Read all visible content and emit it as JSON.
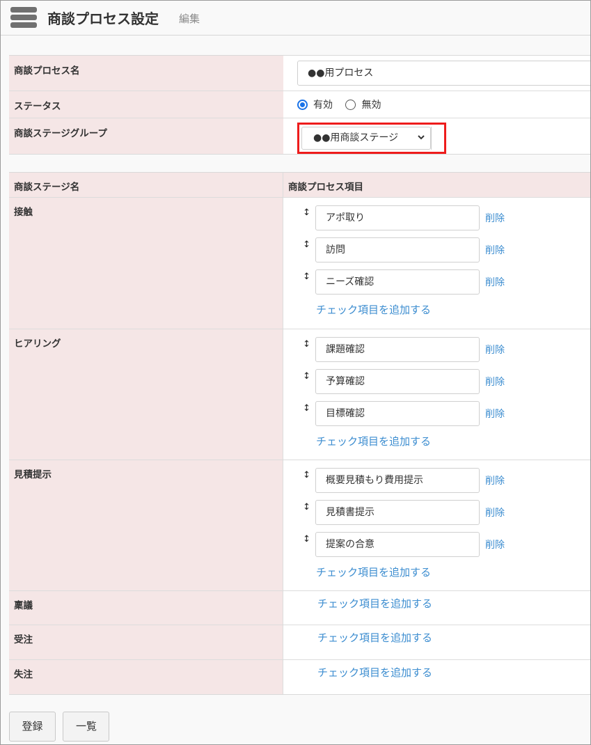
{
  "header": {
    "title": "商談プロセス設定",
    "subtitle": "編集"
  },
  "form": {
    "process_name": {
      "label": "商談プロセス名",
      "value": "●●用プロセス"
    },
    "status": {
      "label": "ステータス",
      "options": [
        "有効",
        "無効"
      ],
      "selected": "有効"
    },
    "stage_group": {
      "label": "商談ステージグループ",
      "value": "●●用商談ステージ"
    }
  },
  "stages_table": {
    "headers": [
      "商談ステージ名",
      "商談プロセス項目"
    ],
    "add_label": "チェック項目を追加する",
    "delete_label": "削除",
    "stages": [
      {
        "name": "接触",
        "items": [
          "アポ取り",
          "訪問",
          "ニーズ確認"
        ]
      },
      {
        "name": "ヒアリング",
        "items": [
          "課題確認",
          "予算確認",
          "目標確認"
        ]
      },
      {
        "name": "見積提示",
        "items": [
          "概要見積もり費用提示",
          "見積書提示",
          "提案の合意"
        ]
      },
      {
        "name": "稟議",
        "items": []
      },
      {
        "name": "受注",
        "items": []
      },
      {
        "name": "失注",
        "items": []
      }
    ]
  },
  "buttons": {
    "register": "登録",
    "list": "一覧"
  },
  "colors": {
    "accent": "#3c8dd0",
    "highlight": "#ee1c1c",
    "label_bg": "#f5e6e6"
  }
}
